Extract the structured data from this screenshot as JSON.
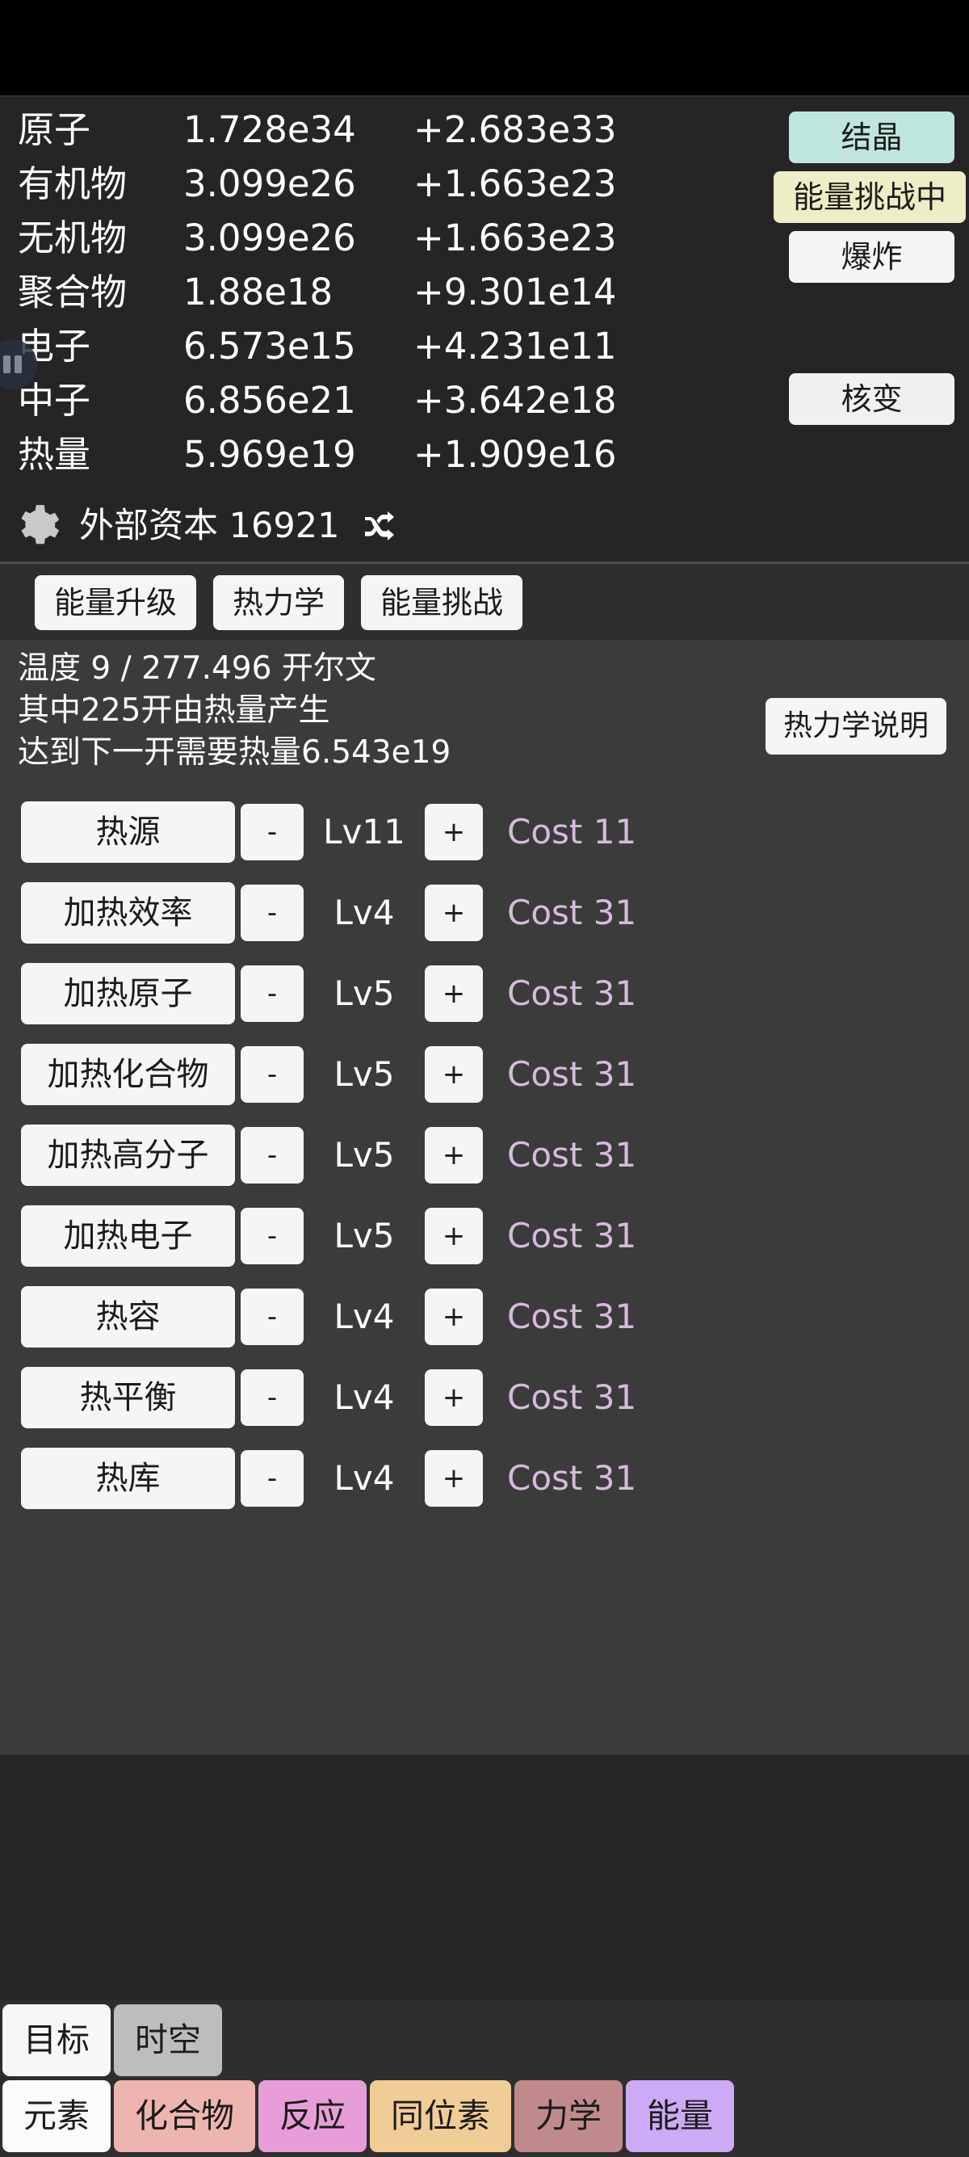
{
  "resources": {
    "columns": [
      "name",
      "value",
      "delta"
    ],
    "rows": [
      {
        "name": "原子",
        "value": "1.728e34",
        "delta": "+2.683e33"
      },
      {
        "name": "有机物",
        "value": "3.099e26",
        "delta": "+1.663e23"
      },
      {
        "name": "无机物",
        "value": "3.099e26",
        "delta": "+1.663e23"
      },
      {
        "name": "聚合物",
        "value": "1.88e18",
        "delta": "+9.301e14"
      },
      {
        "name": "电子",
        "value": "6.573e15",
        "delta": "+4.231e11"
      },
      {
        "name": "中子",
        "value": "6.856e21",
        "delta": "+3.642e18"
      },
      {
        "name": "热量",
        "value": "5.969e19",
        "delta": "+1.909e16"
      }
    ]
  },
  "actions": [
    {
      "label": "结晶",
      "color": "#bfe6dd"
    },
    {
      "label": "能量挑战中",
      "color": "#edeec5"
    },
    {
      "label": "爆炸",
      "color": "#f5f5f5"
    },
    {
      "label": "核变",
      "color": "#f0f0f0"
    }
  ],
  "capital": {
    "gear_icon": "gear-icon",
    "label": "外部资本 16921",
    "shuffle_icon": "shuffle-icon"
  },
  "tabs": [
    {
      "label": "能量升级"
    },
    {
      "label": "热力学"
    },
    {
      "label": "能量挑战"
    }
  ],
  "thermo": {
    "line1": "温度 9 / 277.496 开尔文",
    "line2": "其中225开由热量产生",
    "line3": "达到下一开需要热量6.543e19",
    "help_label": "热力学说明"
  },
  "upgrades": {
    "minus_label": "-",
    "plus_label": "+",
    "rows": [
      {
        "name": "热源",
        "level": "Lv11",
        "cost": "Cost 11"
      },
      {
        "name": "加热效率",
        "level": "Lv4",
        "cost": "Cost 31"
      },
      {
        "name": "加热原子",
        "level": "Lv5",
        "cost": "Cost 31"
      },
      {
        "name": "加热化合物",
        "level": "Lv5",
        "cost": "Cost 31"
      },
      {
        "name": "加热高分子",
        "level": "Lv5",
        "cost": "Cost 31"
      },
      {
        "name": "加热电子",
        "level": "Lv5",
        "cost": "Cost 31"
      },
      {
        "name": "热容",
        "level": "Lv4",
        "cost": "Cost 31"
      },
      {
        "name": "热平衡",
        "level": "Lv4",
        "cost": "Cost 31"
      },
      {
        "name": "热库",
        "level": "Lv4",
        "cost": "Cost 31"
      }
    ]
  },
  "bottom_nav_top": [
    {
      "label": "目标",
      "color": "#f7f7f7"
    },
    {
      "label": "时空",
      "color": "#bdbdbd"
    }
  ],
  "bottom_nav_main": [
    {
      "label": "元素",
      "color": "#fbfbfb"
    },
    {
      "label": "化合物",
      "color": "#eeb5b0"
    },
    {
      "label": "反应",
      "color": "#e79ed8"
    },
    {
      "label": "同位素",
      "color": "#f0cc96"
    },
    {
      "label": "力学",
      "color": "#c08a8c"
    },
    {
      "label": "能量",
      "color": "#ccaaf5"
    }
  ],
  "colors": {
    "window_bg": "#252525",
    "content_bg": "#3b3b3b",
    "cost_text": "#d9b8e0"
  }
}
